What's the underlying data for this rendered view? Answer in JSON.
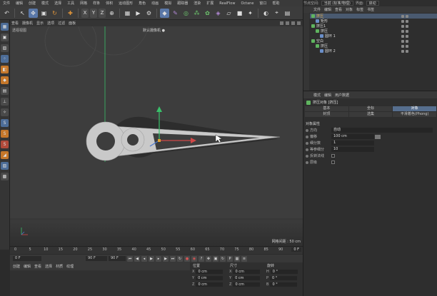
{
  "menubar": {
    "items": [
      "文件",
      "编辑",
      "创建",
      "模式",
      "选择",
      "工具",
      "网格",
      "样条",
      "体积",
      "运动图形",
      "角色",
      "动画",
      "模拟",
      "跟踪器",
      "渲染",
      "扩展",
      "RealFlow",
      "Octane",
      "窗口",
      "帮助"
    ],
    "layout_label": "节点空间:",
    "layout_value": "当前 (标准/物理)",
    "ui_label": "界面:",
    "ui_value": "启动"
  },
  "toolbar": {
    "icons": [
      "undo-icon",
      "live-select-icon",
      "move-icon",
      "scale-icon",
      "rotate-icon",
      "add-icon",
      "x-axis-icon",
      "y-axis-icon",
      "z-axis-icon",
      "coordinate-icon",
      "render-region-icon",
      "render-view-icon",
      "render-settings-icon",
      "cube-icon",
      "pen-icon",
      "subdivision-icon",
      "array-icon",
      "mograph-icon",
      "deformer-icon",
      "floor-icon",
      "camera-icon",
      "light-icon",
      "edit-render-icon",
      "snap-icon",
      "workplane-icon"
    ],
    "axes": [
      "X",
      "Y",
      "Z"
    ]
  },
  "viewport": {
    "menu": [
      "查看",
      "摄像机",
      "显示",
      "选项",
      "过滤",
      "面板"
    ],
    "view_label": "透视视图",
    "camera_label": "默认摄像机 ●",
    "grid_note": "网格间距 : 50 cm"
  },
  "timeline": {
    "ticks": [
      "0",
      "5",
      "10",
      "15",
      "20",
      "25",
      "30",
      "35",
      "40",
      "45",
      "50",
      "55",
      "60",
      "65",
      "70",
      "75",
      "80",
      "85",
      "90"
    ],
    "current_frame": "0 F",
    "start_field": "0 F",
    "end_field": "90 F",
    "end_field2": "90 F",
    "current_field": "0 F"
  },
  "material_panel": {
    "menu": [
      "创建",
      "编辑",
      "查看",
      "选择",
      "材质",
      "纹理"
    ]
  },
  "coordinates": {
    "headers": [
      "位置",
      "尺寸",
      "旋转"
    ],
    "rows": [
      {
        "pos_k": "X",
        "pos_v": "0 cm",
        "size_k": "X",
        "size_v": "0 cm",
        "rot_k": "H",
        "rot_v": "0 °"
      },
      {
        "pos_k": "Y",
        "pos_v": "0 cm",
        "size_k": "Y",
        "size_v": "0 cm",
        "rot_k": "P",
        "rot_v": "0 °"
      },
      {
        "pos_k": "Z",
        "pos_v": "0 cm",
        "size_k": "Z",
        "size_v": "0 cm",
        "rot_k": "B",
        "rot_v": "0 °"
      }
    ]
  },
  "object_manager": {
    "menu": [
      "文件",
      "编辑",
      "查看",
      "对象",
      "标签",
      "书签"
    ],
    "rows": [
      {
        "indent": 0,
        "icon": "g",
        "name": "挤压",
        "highlight": true,
        "selected": true
      },
      {
        "indent": 1,
        "icon": "b",
        "name": "矩形",
        "highlight": false,
        "selected": false
      },
      {
        "indent": 0,
        "icon": "g",
        "name": "挤压1",
        "highlight": false,
        "selected": false
      },
      {
        "indent": 1,
        "icon": "g",
        "name": "挤压",
        "highlight": false,
        "selected": false
      },
      {
        "indent": 2,
        "icon": "b",
        "name": "圆环 1",
        "highlight": false,
        "selected": false
      },
      {
        "indent": 0,
        "icon": "g",
        "name": "空白",
        "highlight": false,
        "selected": false
      },
      {
        "indent": 1,
        "icon": "g",
        "name": "挤压",
        "highlight": false,
        "selected": false
      },
      {
        "indent": 2,
        "icon": "b",
        "name": "圆环 2",
        "highlight": false,
        "selected": false
      }
    ]
  },
  "attribute_manager": {
    "menu": [
      "模式",
      "编辑",
      "用户数据"
    ],
    "object_title": "挤压对象 [挤压]",
    "tabs": [
      "基本",
      "坐标",
      "对象",
      "封顶",
      "选集",
      "平滑着色(Phong)"
    ],
    "active_tab_index": 2,
    "section": "对象属性",
    "fields": [
      {
        "label": "方向",
        "value": "自动",
        "type": "wide"
      },
      {
        "label": "偏移",
        "value": "100 cm",
        "type": "mid",
        "bar": true
      },
      {
        "label": "细分数",
        "value": "1",
        "type": "mid"
      },
      {
        "label": "等参细分",
        "value": "10",
        "type": "mid"
      },
      {
        "label": "反转法线",
        "value": "",
        "type": "check"
      },
      {
        "label": "层级",
        "value": "",
        "type": "check"
      }
    ]
  },
  "colors": {
    "accent_blue": "#5a78a8",
    "highlight_name": "#e8b04c",
    "axis_green": "#39c06a",
    "axis_red": "#d04848",
    "object_fill": "#c9c9c9"
  }
}
